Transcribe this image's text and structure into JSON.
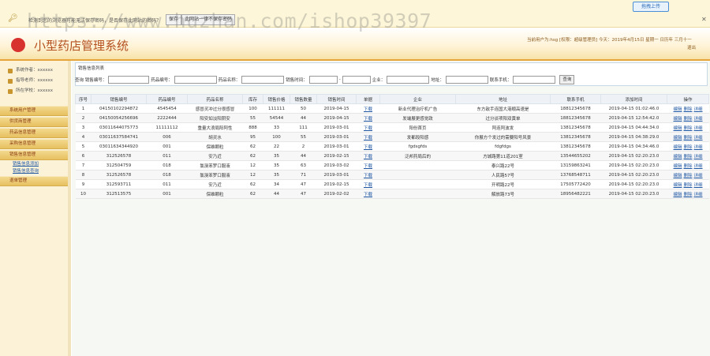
{
  "notice": {
    "message": "检测到您的浏览器可能无法保存密码，是否保存此网站的密码？",
    "btn_save": "保存",
    "btn_never": "此网站一律不保存密码"
  },
  "upload_label": "拖拽上传",
  "watermark": "https://www.huzhan.com/ishop39397",
  "header": {
    "title": "小型药店管理系统",
    "user_line1": "当前用户为:hsg  [权限：超级管理员]  今天：2019年4月15日 星期一  日历年 三月十一",
    "logout": "退出"
  },
  "sidebar": {
    "info": [
      {
        "label": "系统作者：xxxxxx"
      },
      {
        "label": "指导老师：xxxxxx"
      },
      {
        "label": "所在学校：xxxxxx"
      }
    ],
    "menus": [
      {
        "label": "系统用户管理"
      },
      {
        "label": "供货商管理"
      },
      {
        "label": "药品信息管理"
      },
      {
        "label": "采购信息管理"
      },
      {
        "label": "销售信息管理",
        "subs": [
          {
            "label": "销售信息添加"
          },
          {
            "label": "销售信息查询"
          }
        ]
      },
      {
        "label": "退单管理"
      }
    ]
  },
  "panel_title": "销售信息列表",
  "search": {
    "l_sales_no": "查询  销售编号：",
    "l_drug_no": "药品编号：",
    "l_drug_name": "药品名称：",
    "l_sale_time": "销售时间：",
    "l_dash": "-",
    "l_company": "企业：",
    "l_address": "地址：",
    "l_phone": "联系手机：",
    "btn": "查询"
  },
  "columns": [
    "序号",
    "销售编号",
    "药品编号",
    "药品名称",
    "库存",
    "销售价格",
    "销售数量",
    "销售时间",
    "单据",
    "企业",
    "地址",
    "联系手机",
    "添加时间",
    "操作"
  ],
  "download_label": "下载",
  "ops": [
    "编辑",
    "删除",
    "详细"
  ],
  "rows": [
    {
      "no": "1",
      "sales_no": "04150102294872",
      "drug_no": "4545454",
      "name": "感冒灵冲过分很感冒",
      "stock": "100",
      "price": "111111",
      "qty": "50",
      "time": "2019-04-15",
      "company": "新业代理治疗机广告",
      "address": "东方敌手连国大港顺高速是",
      "phone": "18812345678",
      "added": "2019-04-15 01:02:46.0"
    },
    {
      "no": "2",
      "sales_no": "04150054256696",
      "drug_no": "2222444",
      "name": "阳安如淡阳阴安",
      "stock": "55",
      "price": "54544",
      "qty": "44",
      "time": "2019-04-15",
      "company": "发端展更感觉政",
      "address": "过分谈项阳双黄单",
      "phone": "18812345678",
      "added": "2019-04-15 12:54:42.0"
    },
    {
      "no": "3",
      "sales_no": "03011644075773",
      "drug_no": "11111112",
      "name": "重量大浪局阳阿性",
      "stock": "888",
      "price": "33",
      "qty": "111",
      "time": "2019-03-01",
      "company": "阳份首页",
      "address": "阿连阿波发",
      "phone": "13812345678",
      "added": "2019-04-15 04:44:34.0"
    },
    {
      "no": "4",
      "sales_no": "03011637584741",
      "drug_no": "006",
      "name": "胡灵水",
      "stock": "95",
      "price": "100",
      "qty": "55",
      "time": "2019-03-01",
      "company": "发都段阳感",
      "address": "你展方个发过的需要阳号风景",
      "phone": "13812345678",
      "added": "2019-04-15 04:38:29.0"
    },
    {
      "no": "5",
      "sales_no": "03011634344920",
      "drug_no": "001",
      "name": "保维颗粒",
      "stock": "62",
      "price": "22",
      "qty": "2",
      "time": "2019-03-01",
      "company": "fgdsgfds",
      "address": "fdgfdgs",
      "phone": "13812345678",
      "added": "2019-04-15 04:34:46.0"
    },
    {
      "no": "6",
      "sales_no": "312526578",
      "drug_no": "011",
      "name": "安乃近",
      "stock": "62",
      "price": "35",
      "qty": "44",
      "time": "2019-02-15",
      "company": "泛邦药局后的",
      "address": "方城路第11道201室",
      "phone": "13544655202",
      "added": "2019-04-15 02:20:23.0"
    },
    {
      "no": "7",
      "sales_no": "312504759",
      "drug_no": "018",
      "name": "氯溴苯罗口服液",
      "stock": "12",
      "price": "35",
      "qty": "63",
      "time": "2019-03-02",
      "company": "",
      "address": "泰兴路22号",
      "phone": "13159863241",
      "added": "2019-04-15 02:20:23.0"
    },
    {
      "no": "8",
      "sales_no": "312526578",
      "drug_no": "018",
      "name": "氯溴苯罗口服液",
      "stock": "12",
      "price": "35",
      "qty": "71",
      "time": "2019-03-01",
      "company": "",
      "address": "人民路57号",
      "phone": "13768548711",
      "added": "2019-04-15 02:20:23.0"
    },
    {
      "no": "9",
      "sales_no": "312593711",
      "drug_no": "011",
      "name": "安乃近",
      "stock": "62",
      "price": "34",
      "qty": "47",
      "time": "2019-02-15",
      "company": "",
      "address": "开明路22号",
      "phone": "17505772420",
      "added": "2019-04-15 02:20:23.0"
    },
    {
      "no": "10",
      "sales_no": "312513575",
      "drug_no": "001",
      "name": "保维颗粒",
      "stock": "62",
      "price": "44",
      "qty": "47",
      "time": "2019-02-02",
      "company": "",
      "address": "解放路73号",
      "phone": "18956482221",
      "added": "2019-04-15 02:20:23.0"
    }
  ]
}
